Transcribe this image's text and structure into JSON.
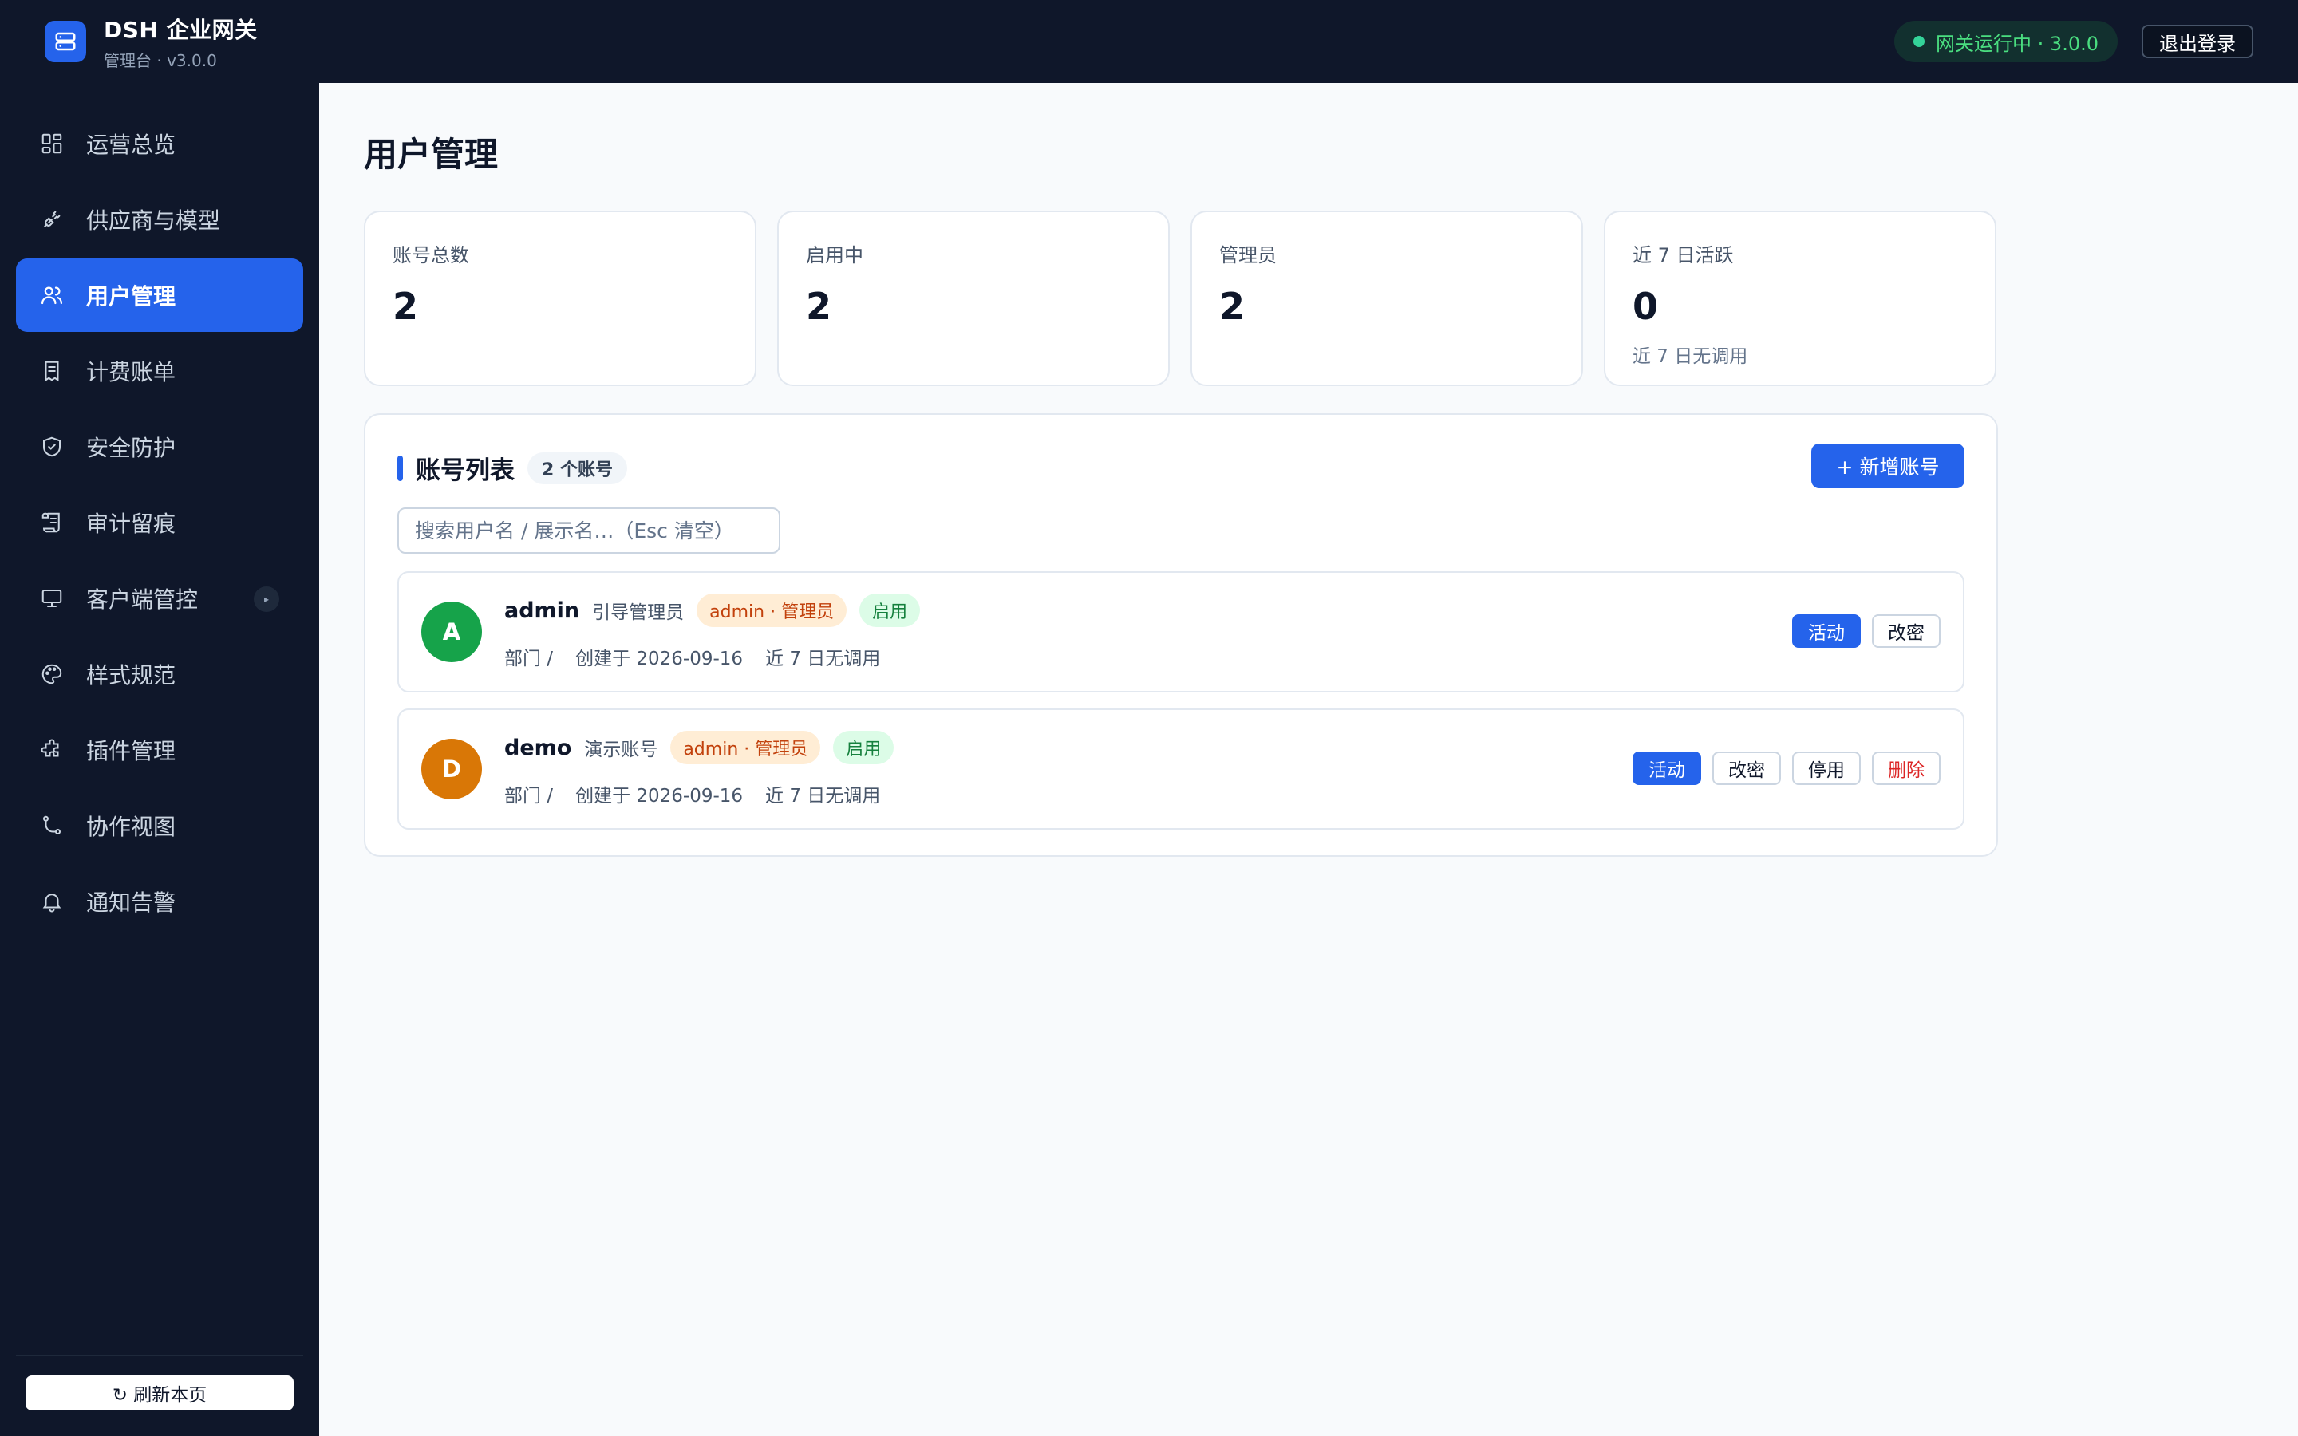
{
  "header": {
    "brand_title": "DSH 企业网关",
    "brand_subtitle": "管理台 · v3.0.0",
    "status_text": "网关运行中 · 3.0.0",
    "logout_label": "退出登录"
  },
  "sidebar": {
    "items": [
      {
        "label": "运营总览",
        "icon": "dashboard-icon"
      },
      {
        "label": "供应商与模型",
        "icon": "plug-icon"
      },
      {
        "label": "用户管理",
        "icon": "users-icon",
        "active": true
      },
      {
        "label": "计费账单",
        "icon": "receipt-icon"
      },
      {
        "label": "安全防护",
        "icon": "shield-icon"
      },
      {
        "label": "审计留痕",
        "icon": "scroll-icon"
      },
      {
        "label": "客户端管控",
        "icon": "monitor-icon",
        "expand_glyph": "▸"
      },
      {
        "label": "样式规范",
        "icon": "palette-icon"
      },
      {
        "label": "插件管理",
        "icon": "puzzle-icon"
      },
      {
        "label": "协作视图",
        "icon": "git-branch-icon"
      },
      {
        "label": "通知告警",
        "icon": "bell-icon"
      }
    ],
    "refresh_label": "↻ 刷新本页"
  },
  "main": {
    "page_title": "用户管理",
    "stats": [
      {
        "label": "账号总数",
        "value": "2",
        "sub": ""
      },
      {
        "label": "启用中",
        "value": "2",
        "sub": ""
      },
      {
        "label": "管理员",
        "value": "2",
        "sub": ""
      },
      {
        "label": "近 7 日活跃",
        "value": "0",
        "sub": "近 7 日无调用"
      }
    ],
    "list": {
      "title": "账号列表",
      "count_badge": "2 个账号",
      "add_label": "+ 新增账号",
      "search_placeholder": "搜索用户名 / 展示名…（Esc 清空）",
      "users": [
        {
          "initial": "A",
          "username": "admin",
          "display_name": "引导管理员",
          "role_tag": "admin · 管理员",
          "status_tag": "启用",
          "department": "部门 /",
          "created": "创建于 2026-09-16",
          "activity": "近 7 日无调用",
          "avatar_color": "#16a34a",
          "actions": {
            "activity": "活动",
            "password": "改密"
          }
        },
        {
          "initial": "D",
          "username": "demo",
          "display_name": "演示账号",
          "role_tag": "admin · 管理员",
          "status_tag": "启用",
          "department": "部门 /",
          "created": "创建于 2026-09-16",
          "activity": "近 7 日无调用",
          "avatar_color": "#d97706",
          "actions": {
            "activity": "活动",
            "password": "改密",
            "disable": "停用",
            "delete": "删除"
          }
        }
      ]
    }
  },
  "colors": {
    "accent": "#2563eb",
    "sidebar_bg": "#0f172a",
    "status_green": "#4ade80",
    "danger": "#dc2626"
  }
}
